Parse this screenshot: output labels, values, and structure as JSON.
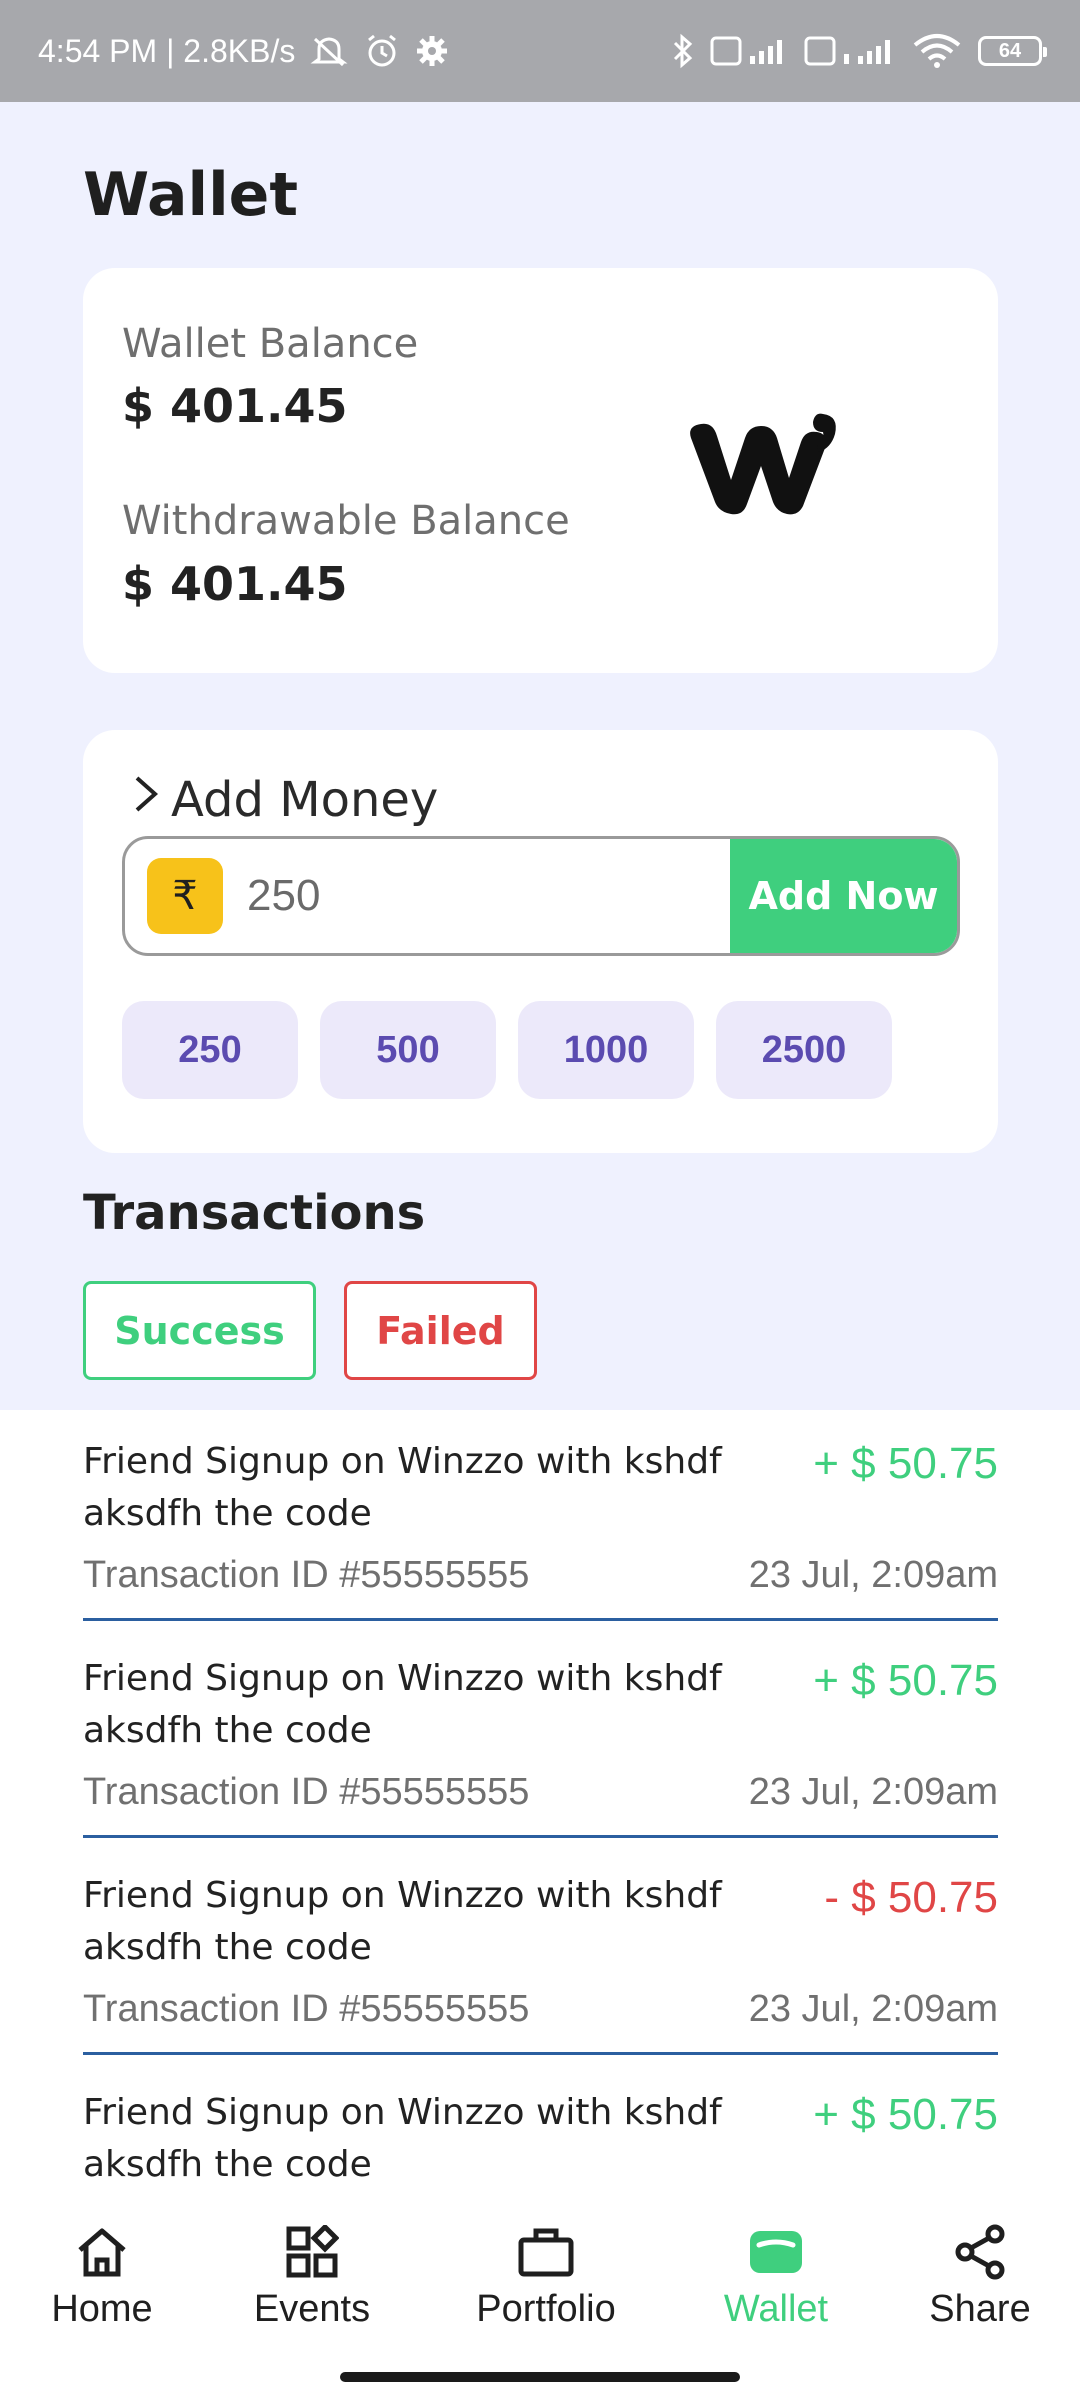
{
  "status_bar": {
    "time_and_speed": "4:54 PM | 2.8KB/s",
    "battery": "64"
  },
  "page": {
    "title": "Wallet"
  },
  "balance": {
    "wallet_label": "Wallet Balance",
    "wallet_value": "$ 401.45",
    "withdrawable_label": "Withdrawable Balance",
    "withdrawable_value": "$ 401.45",
    "logo_icon": "winzo-logo"
  },
  "add_money": {
    "title": "Add Money",
    "currency_symbol": "₹",
    "amount_value": "250",
    "button_label": "Add Now",
    "presets": [
      "250",
      "500",
      "1000",
      "2500"
    ]
  },
  "transactions": {
    "title": "Transactions",
    "filters": {
      "success": "Success",
      "failed": "Failed"
    },
    "items": [
      {
        "description": "Friend Signup on Winzzo with kshdf aksdfh the code",
        "amount": "+ $ 50.75",
        "type": "credit",
        "id": "Transaction ID #55555555",
        "date": "23 Jul, 2:09am"
      },
      {
        "description": "Friend Signup on Winzzo with kshdf aksdfh the code",
        "amount": "+ $ 50.75",
        "type": "credit",
        "id": "Transaction ID #55555555",
        "date": "23 Jul, 2:09am"
      },
      {
        "description": "Friend Signup on Winzzo with kshdf aksdfh the code",
        "amount": "- $ 50.75",
        "type": "debit",
        "id": "Transaction ID #55555555",
        "date": "23 Jul, 2:09am"
      },
      {
        "description": "Friend Signup on Winzzo with kshdf aksdfh the code",
        "amount": "+ $ 50.75",
        "type": "credit",
        "id": "",
        "date": ""
      }
    ]
  },
  "nav": {
    "home": "Home",
    "events": "Events",
    "portfolio": "Portfolio",
    "wallet": "Wallet",
    "share": "Share"
  },
  "colors": {
    "accent_green": "#3fcf7e",
    "error_red": "#e04646",
    "chip_text": "#5b4bb0",
    "page_bg": "#eff1fe"
  }
}
